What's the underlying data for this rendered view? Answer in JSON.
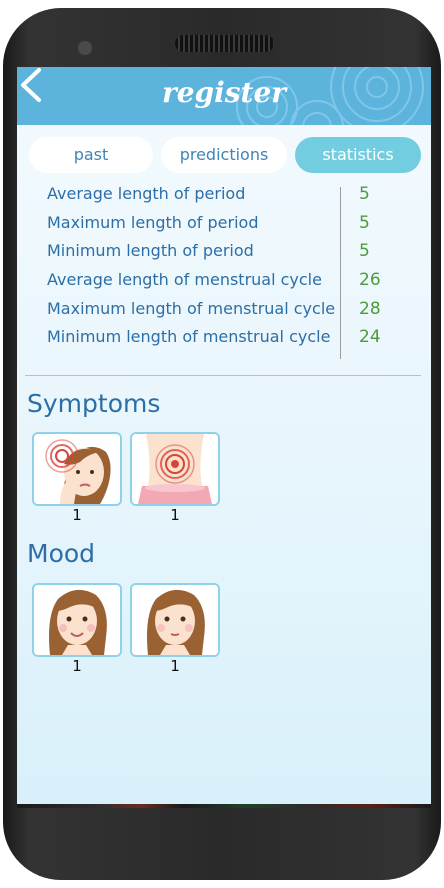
{
  "header": {
    "title": "register",
    "back_icon": "chevron-left-icon"
  },
  "tabs": [
    {
      "label": "past",
      "active": false
    },
    {
      "label": "predictions",
      "active": false
    },
    {
      "label": "statistics",
      "active": true
    }
  ],
  "statistics": [
    {
      "label": "Average length of period",
      "value": "5"
    },
    {
      "label": "Maximum length of period",
      "value": "5"
    },
    {
      "label": "Minimum length of period",
      "value": "5"
    },
    {
      "label": "Average length of menstrual cycle",
      "value": "26"
    },
    {
      "label": "Maximum length of menstrual cycle",
      "value": "28"
    },
    {
      "label": "Minimum length of menstrual cycle",
      "value": "24"
    }
  ],
  "symptoms": {
    "heading": "Symptoms",
    "items": [
      {
        "icon": "headache-face-icon",
        "count": "1"
      },
      {
        "icon": "abdominal-pain-icon",
        "count": "1"
      }
    ]
  },
  "mood": {
    "heading": "Mood",
    "items": [
      {
        "icon": "happy-face-icon",
        "count": "1"
      },
      {
        "icon": "calm-face-icon",
        "count": "1"
      }
    ]
  },
  "colors": {
    "header": "#5cb3dc",
    "active_tab": "#73cde0",
    "label_text": "#2c6ea6",
    "value_text": "#4f9a3a"
  }
}
